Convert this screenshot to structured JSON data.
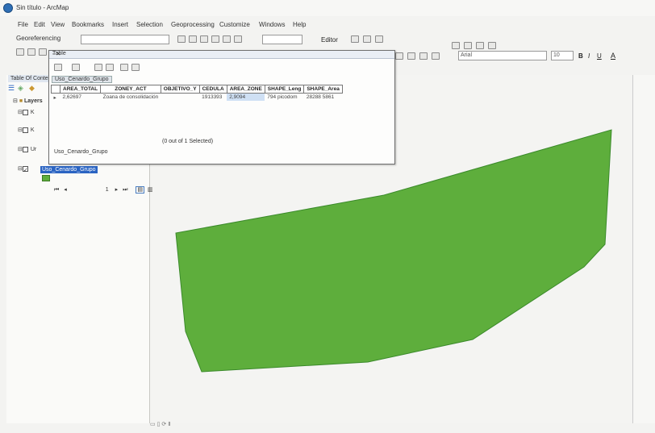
{
  "window": {
    "title": "Sin título - ArcMap"
  },
  "menu": [
    "File",
    "Edit",
    "View",
    "Bookmarks",
    "Insert",
    "Selection",
    "Geoprocessing",
    "Customize",
    "Windows",
    "Help"
  ],
  "toolbar": {
    "georeferencing_label": "Georeferencing",
    "editor_label": "Editor",
    "font_name": "Arial",
    "font_size": "10"
  },
  "toc": {
    "title": "Table Of Contents",
    "layers_label": "Layers",
    "items": [
      "K",
      "K",
      "Ur",
      "Uso_Cenardo_Grupo"
    ],
    "selected_layer": "Uso_Cenardo_Grupo"
  },
  "table_window": {
    "title": "Table",
    "tab_name": "Uso_Cenardo_Grupo",
    "bottom_tab": "Uso_Cenardo_Grupo",
    "columns": [
      "AREA_TOTAL",
      "ZONEY_ACT",
      "OBJETIVO_Y",
      "CEDULA",
      "AREA_ZONE",
      "SHAPE_Leng",
      "SHAPE_Area"
    ],
    "rows": [
      [
        "2,62697",
        "Zoana de consolidación",
        "",
        "1913393",
        "2,9094",
        "794 picodom",
        "28288 5861"
      ]
    ],
    "nav_record": "1",
    "selection_status": "(0 out of 1 Selected)"
  },
  "map": {
    "polygon_fill": "#5eae3c",
    "polygon_stroke": "#3a8a2a"
  },
  "colors": {
    "selection_blue": "#2b64c2"
  }
}
